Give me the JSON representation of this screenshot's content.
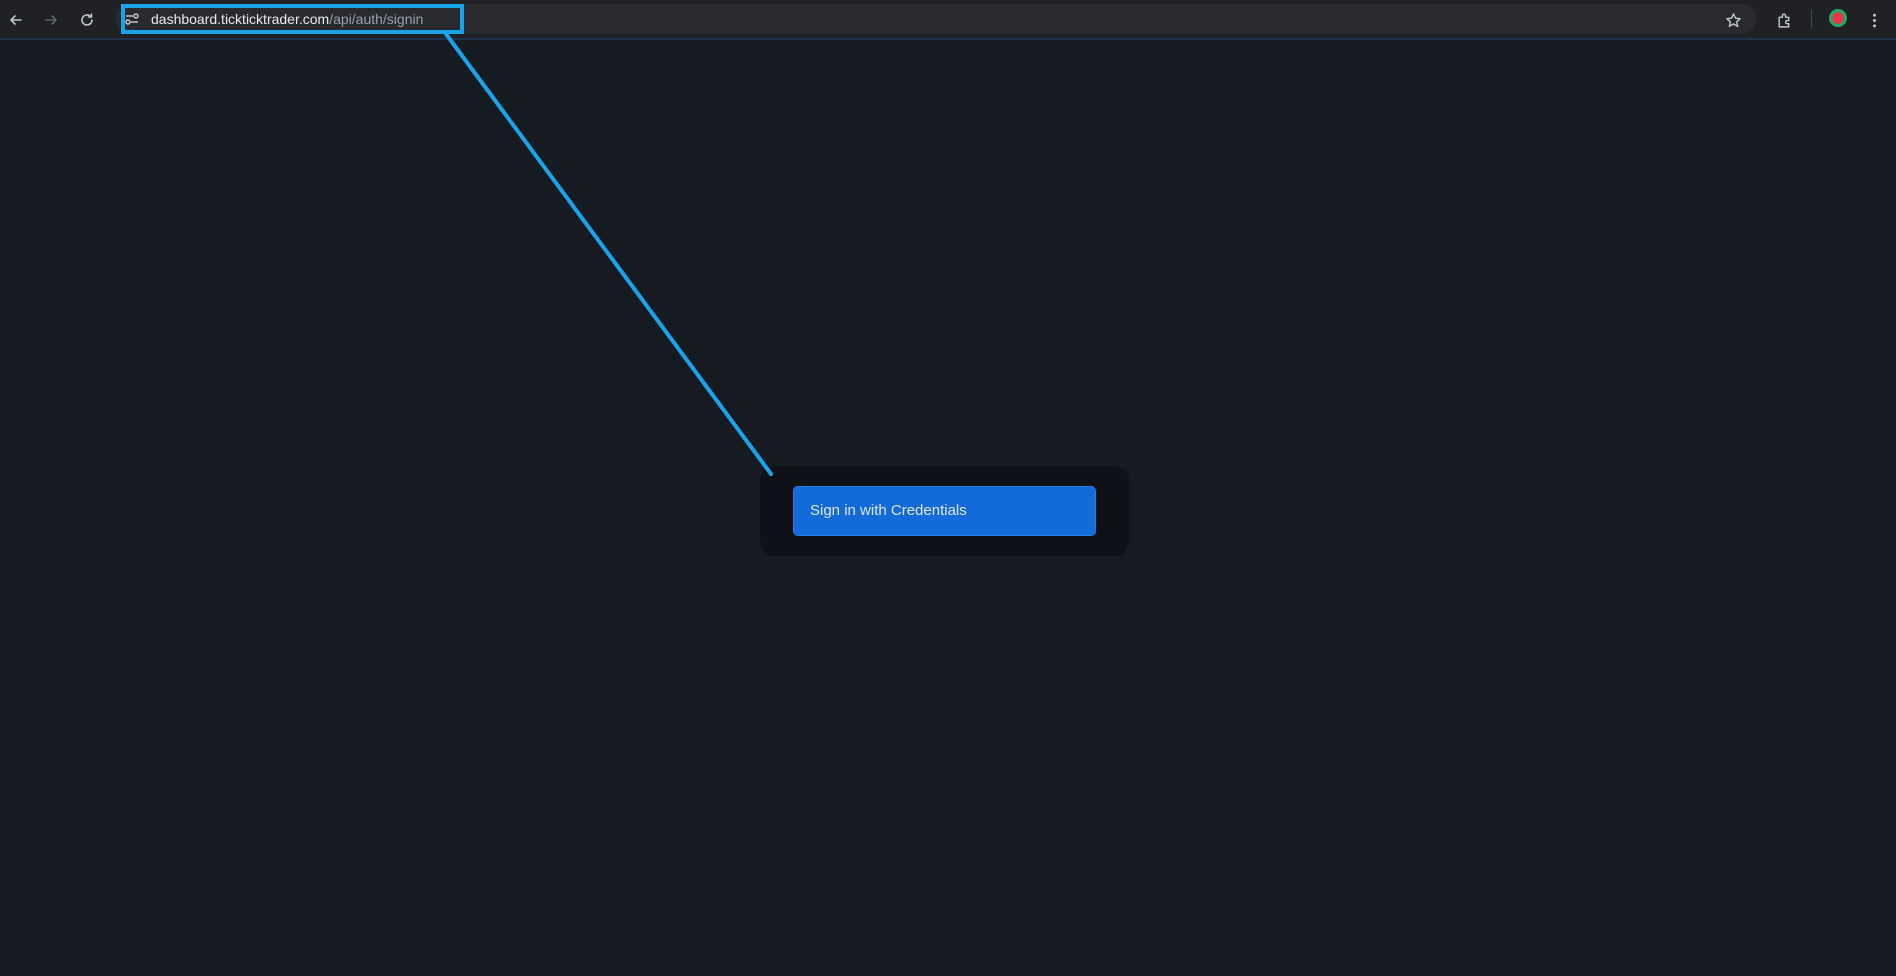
{
  "browser": {
    "url_host": "dashboard.tickticktrader.com",
    "url_path": "/api/auth/signin",
    "icons": {
      "back": "back-arrow-icon",
      "forward": "forward-arrow-icon",
      "reload": "reload-icon",
      "site_info": "site-info-icon",
      "bookmark": "star-icon",
      "extensions": "puzzle-icon",
      "profile": "profile-avatar",
      "menu": "kebab-menu-icon"
    }
  },
  "page": {
    "signin_button_label": "Sign in with Credentials"
  },
  "colors": {
    "background": "#161b22",
    "card": "#0e1117",
    "button": "#136ad9",
    "annotation": "#1aa3e8"
  }
}
